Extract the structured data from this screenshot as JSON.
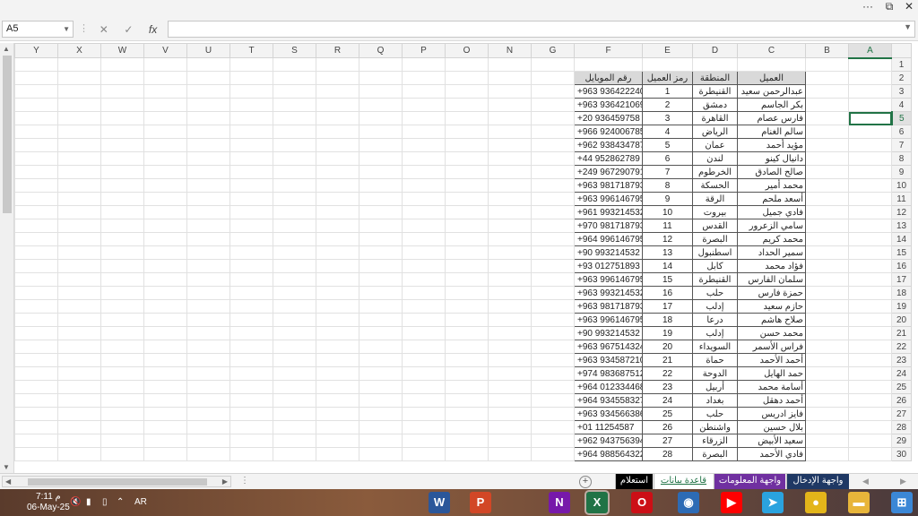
{
  "window": {
    "more_label": "···",
    "restore_label": "⧉",
    "close_label": "✕"
  },
  "formula_bar": {
    "name_box": "A5",
    "fx_label": "fx",
    "value": ""
  },
  "columns": [
    "Y",
    "X",
    "W",
    "V",
    "U",
    "T",
    "S",
    "R",
    "Q",
    "P",
    "O",
    "N",
    "G",
    "F",
    "E",
    "D",
    "C",
    "B",
    "A"
  ],
  "rows": [
    "1",
    "2",
    "3",
    "4",
    "5",
    "6",
    "7",
    "8",
    "9",
    "10",
    "11",
    "12",
    "13",
    "14",
    "15",
    "16",
    "17",
    "18",
    "19",
    "20",
    "21",
    "22",
    "23",
    "24",
    "25",
    "26",
    "27",
    "28",
    "29",
    "30"
  ],
  "table": {
    "headers": {
      "name": "العميل",
      "region": "المنطقة",
      "code": "رمز العميل",
      "phone": "رقم الموبايل"
    },
    "records": [
      {
        "name": "عبدالرحمن سعيد",
        "region": "القنيطرة",
        "code": "1",
        "phone": "+963 936422240"
      },
      {
        "name": "بكر الجاسم",
        "region": "دمشق",
        "code": "2",
        "phone": "+963 936421069"
      },
      {
        "name": "فارس عصام",
        "region": "القاهرة",
        "code": "3",
        "phone": "+20 936459758"
      },
      {
        "name": "سالم الغنام",
        "region": "الرياض",
        "code": "4",
        "phone": "+966 924006785"
      },
      {
        "name": "مؤيد أحمد",
        "region": "عمان",
        "code": "5",
        "phone": "+962 938434787"
      },
      {
        "name": "دانيال كينو",
        "region": "لندن",
        "code": "6",
        "phone": "+44 952862789"
      },
      {
        "name": "صالح الصادق",
        "region": "الخرطوم",
        "code": "7",
        "phone": "+249 967290791"
      },
      {
        "name": "محمد أمير",
        "region": "الحسكة",
        "code": "8",
        "phone": "+963 981718793"
      },
      {
        "name": "أسعد ملحم",
        "region": "الرقة",
        "code": "9",
        "phone": "+963 996146795"
      },
      {
        "name": "فادي جميل",
        "region": "بيروت",
        "code": "10",
        "phone": "+961 993214532"
      },
      {
        "name": "سامي الزعرور",
        "region": "القدس",
        "code": "11",
        "phone": "+970 981718793"
      },
      {
        "name": "محمد كريم",
        "region": "البصرة",
        "code": "12",
        "phone": "+964 996146795"
      },
      {
        "name": "سمير الحداد",
        "region": "اسطنبول",
        "code": "13",
        "phone": "+90 993214532"
      },
      {
        "name": "فؤاد محمد",
        "region": "كابل",
        "code": "14",
        "phone": "+93 012751893"
      },
      {
        "name": "سلمان الفارس",
        "region": "القنيطرة",
        "code": "15",
        "phone": "+963 996146795"
      },
      {
        "name": "حمزة فارس",
        "region": "حلب",
        "code": "16",
        "phone": "+963 993214532"
      },
      {
        "name": "حازم سعيد",
        "region": "إدلب",
        "code": "17",
        "phone": "+963 981718793"
      },
      {
        "name": "صلاح هاشم",
        "region": "درعا",
        "code": "18",
        "phone": "+963 996146795"
      },
      {
        "name": "محمد حسن",
        "region": "إدلب",
        "code": "19",
        "phone": "+90 993214532"
      },
      {
        "name": "فراس الأسمر",
        "region": "السويداء",
        "code": "20",
        "phone": "+963 967514324"
      },
      {
        "name": "أحمد الأحمد",
        "region": "حماة",
        "code": "21",
        "phone": "+963 934587210"
      },
      {
        "name": "حمد الهايل",
        "region": "الدوحة",
        "code": "22",
        "phone": "+974 983687512"
      },
      {
        "name": "أسامة محمد",
        "region": "أربيل",
        "code": "23",
        "phone": "+964 012334468"
      },
      {
        "name": "أحمد دهقل",
        "region": "بغداد",
        "code": "24",
        "phone": "+964 934558327"
      },
      {
        "name": "فايز ادريس",
        "region": "حلب",
        "code": "25",
        "phone": "+963 934566386"
      },
      {
        "name": "بلال حسين",
        "region": "واشنطن",
        "code": "26",
        "phone": "+01 11254587"
      },
      {
        "name": "سعيد الأبيض",
        "region": "الزرقاء",
        "code": "27",
        "phone": "+962 943756394"
      },
      {
        "name": "فادي الأحمد",
        "region": "البصرة",
        "code": "28",
        "phone": "+964 988564322"
      }
    ]
  },
  "sheet_tabs": [
    {
      "label": "واجهة الإدخال",
      "bg": "#1f3864",
      "fg": "#ffffff"
    },
    {
      "label": "واجهة المعلومات",
      "bg": "#7030a0",
      "fg": "#ffffff"
    },
    {
      "label": "قاعدة بيانات",
      "bg": "#ffffff",
      "fg": "#217346"
    },
    {
      "label": "استعلام",
      "bg": "#000000",
      "fg": "#ffffff"
    }
  ],
  "taskbar": {
    "time": "7:11 م",
    "date": "06-May-25",
    "lang": "AR",
    "apps": [
      {
        "icon": "word-icon",
        "glyph": "W",
        "bg": "#2b579a"
      },
      {
        "icon": "powerpoint-icon",
        "glyph": "P",
        "bg": "#d24726"
      },
      {
        "icon": "onenote-icon",
        "glyph": "N",
        "bg": "#7719aa"
      },
      {
        "icon": "excel-icon",
        "glyph": "X",
        "bg": "#217346"
      },
      {
        "icon": "opera-icon",
        "glyph": "O",
        "bg": "#cc0f16"
      },
      {
        "icon": "camera-app-icon",
        "glyph": "◉",
        "bg": "#2d6bb5"
      },
      {
        "icon": "youtube-icon",
        "glyph": "▶",
        "bg": "#ff0000"
      },
      {
        "icon": "telegram-icon",
        "glyph": "➤",
        "bg": "#2aa3df"
      },
      {
        "icon": "chrome-icon",
        "glyph": "●",
        "bg": "#e3b51a"
      },
      {
        "icon": "file-explorer-icon",
        "glyph": "▬",
        "bg": "#e8b53a"
      },
      {
        "icon": "windows-start-icon",
        "glyph": "⊞",
        "bg": "#3b87d6"
      }
    ]
  }
}
